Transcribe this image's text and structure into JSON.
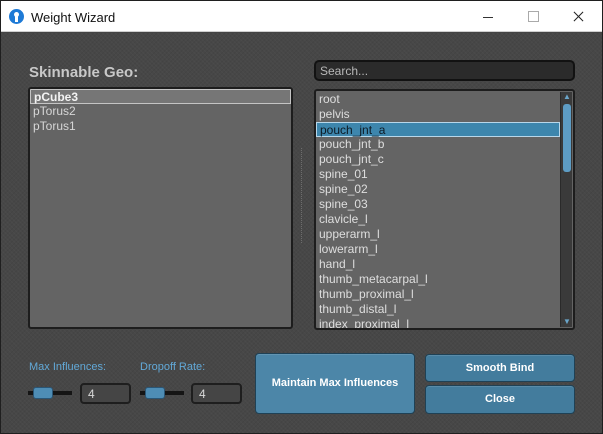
{
  "window": {
    "title": "Weight Wizard",
    "icon": "app-logo-icon"
  },
  "geo": {
    "label": "Skinnable Geo:",
    "items": [
      "pCube3",
      "pTorus2",
      "pTorus1"
    ],
    "selected_index": 0
  },
  "search": {
    "placeholder": "Search...",
    "value": ""
  },
  "joints": {
    "items": [
      "root",
      "pelvis",
      "pouch_jnt_a",
      "pouch_jnt_b",
      "pouch_jnt_c",
      "spine_01",
      "spine_02",
      "spine_03",
      "clavicle_l",
      "upperarm_l",
      "lowerarm_l",
      "hand_l",
      "thumb_metacarpal_l",
      "thumb_proximal_l",
      "thumb_distal_l",
      "index_proximal_l"
    ],
    "selected_index": 2
  },
  "controls": {
    "max_influences_label": "Max Influences:",
    "max_influences_value": "4",
    "max_influences_slider_fraction": 0.1,
    "dropoff_rate_label": "Dropoff Rate:",
    "dropoff_rate_value": "4",
    "dropoff_rate_slider_fraction": 0.1
  },
  "buttons": {
    "maintain": "Maintain Max Influences",
    "smooth_bind": "Smooth Bind",
    "close": "Close"
  },
  "colors": {
    "accent": "#4c86a8",
    "selection": "#3d86ad",
    "label_blue": "#62a9d8"
  }
}
